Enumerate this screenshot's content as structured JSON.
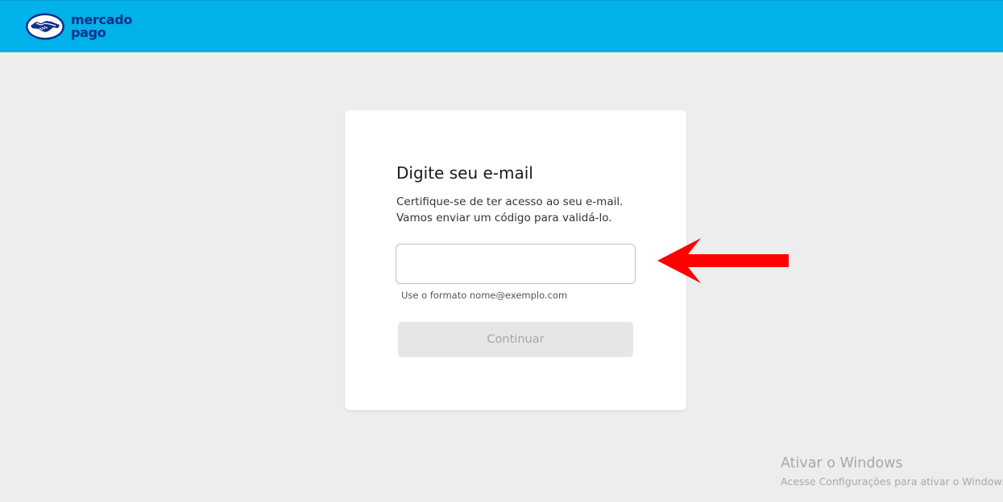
{
  "header": {
    "logo": {
      "line1": "mercado",
      "line2": "pago",
      "icon": "handshake-icon"
    },
    "background_color": "#00b1ea"
  },
  "card": {
    "title": "Digite seu e-mail",
    "subtitle_line1": "Certifique-se de ter acesso ao seu e-mail.",
    "subtitle_line2": "Vamos enviar um código para validá-lo.",
    "email": {
      "value": "",
      "placeholder": ""
    },
    "helper": "Use o formato nome@exemplo.com",
    "continue_label": "Continuar"
  },
  "annotation": {
    "icon": "red-arrow-left-icon",
    "color": "#ff0000"
  },
  "watermark": {
    "title": "Ativar o Windows",
    "subtitle": "Acesse Configurações para ativar o Windows."
  }
}
